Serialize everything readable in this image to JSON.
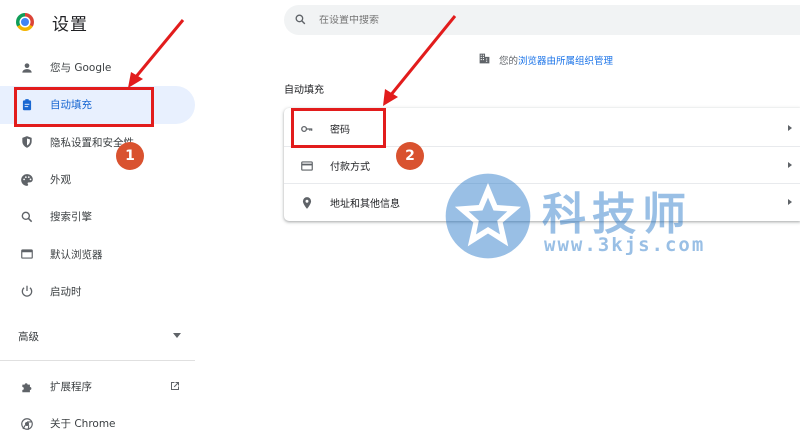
{
  "brand": {
    "title": "设置"
  },
  "sidebar": {
    "items": [
      {
        "label": "您与 Google",
        "icon": "person-icon"
      },
      {
        "label": "自动填充",
        "icon": "clipboard-icon",
        "active": true
      },
      {
        "label": "隐私设置和安全性",
        "icon": "shield-icon"
      },
      {
        "label": "外观",
        "icon": "palette-icon"
      },
      {
        "label": "搜索引擎",
        "icon": "search-icon"
      },
      {
        "label": "默认浏览器",
        "icon": "browser-icon"
      },
      {
        "label": "启动时",
        "icon": "power-icon"
      }
    ],
    "advanced": "高级",
    "bottom": [
      {
        "label": "扩展程序",
        "icon": "puzzle-icon"
      },
      {
        "label": "关于 Chrome",
        "icon": "chrome-icon"
      }
    ]
  },
  "search": {
    "placeholder": "在设置中搜索"
  },
  "managed": {
    "prefix": "您的",
    "link": "浏览器由所属组织管理"
  },
  "section": {
    "title": "自动填充",
    "rows": [
      {
        "label": "密码",
        "icon": "key-icon"
      },
      {
        "label": "付款方式",
        "icon": "credit-card-icon"
      },
      {
        "label": "地址和其他信息",
        "icon": "location-pin-icon"
      }
    ]
  },
  "annotations": {
    "step1": "1",
    "step2": "2"
  },
  "watermark": {
    "title": "科技师",
    "url": "www.3kjs.com"
  },
  "colors": {
    "accent": "#1a73e8",
    "active_bg": "#e8f0fe",
    "annotation_red": "#e21c1c",
    "badge": "#d9522f",
    "watermark": "#1f73c7"
  }
}
